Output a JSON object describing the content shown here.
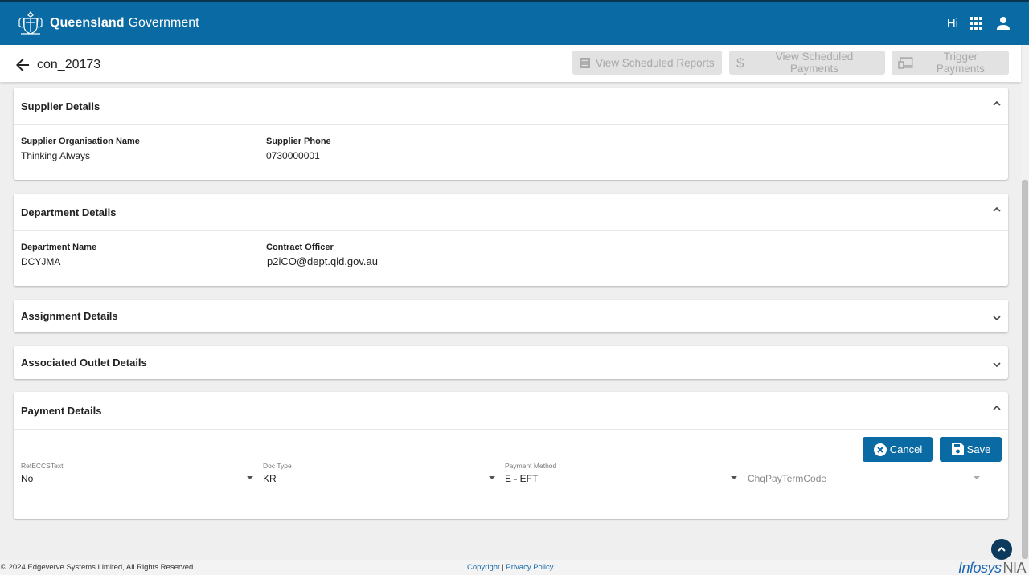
{
  "header": {
    "brand_bold": "Queensland",
    "brand_light": "Government",
    "greeting": "Hi",
    "apps_icon": "apps-grid-icon",
    "user_icon": "person-icon"
  },
  "subheader": {
    "title": "con_20173",
    "actions": {
      "view_reports": "View Scheduled Reports",
      "view_payments": "View Scheduled Payments",
      "trigger_payments": "Trigger Payments"
    }
  },
  "supplier": {
    "title": "Supplier Details",
    "org_label": "Supplier Organisation Name",
    "org_value": "Thinking Always",
    "phone_label": "Supplier Phone",
    "phone_value": "0730000001"
  },
  "department": {
    "title": "Department Details",
    "name_label": "Department Name",
    "name_value": "DCYJMA",
    "officer_label": "Contract Officer",
    "officer_value": "p2iCO@dept.qld.gov.au"
  },
  "assignment": {
    "title": "Assignment Details"
  },
  "outlet": {
    "title": "Associated Outlet Details"
  },
  "payment": {
    "title": "Payment Details",
    "cancel_label": "Cancel",
    "save_label": "Save",
    "fields": {
      "retecc_label": "RetECCSText",
      "retecc_value": "No",
      "doctype_label": "Doc Type",
      "doctype_value": "KR",
      "method_label": "Payment Method",
      "method_value": "E - EFT",
      "chq_placeholder": "ChqPayTermCode"
    }
  },
  "footer": {
    "copyright": "© 2024 Edgeverve Systems Limited, All Rights Reserved",
    "copyright_link": "Copyright",
    "separator": "|",
    "privacy_link": "Privacy Policy",
    "vendor": "Infosys",
    "product": "NIA"
  },
  "colors": {
    "brand": "#0a6aa3",
    "disabled_button": "#e2e2e2",
    "background": "#efefef"
  }
}
